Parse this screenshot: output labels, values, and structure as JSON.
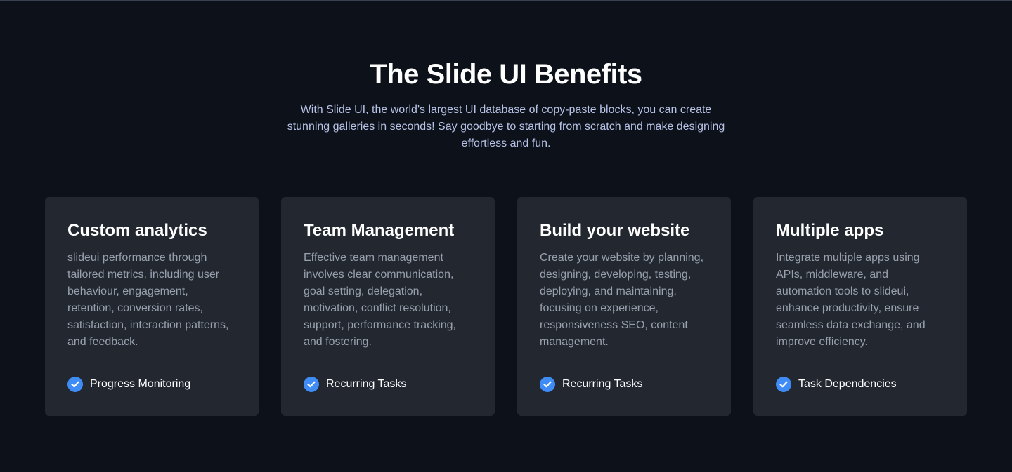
{
  "section": {
    "title": "The Slide UI Benefits",
    "subtitle": "With Slide UI, the world's largest UI database of copy-paste blocks, you can create stunning galleries in seconds! Say goodbye to starting from scratch and make designing effortless and fun."
  },
  "colors": {
    "background": "#0d111a",
    "card": "#232830",
    "accent": "#3f8cf7",
    "subtitle": "#b7c3e6",
    "description": "#98a0ae"
  },
  "cards": [
    {
      "title": "Custom analytics",
      "description": "slideui performance through tailored metrics, including user behaviour, engagement, retention, conversion rates, satisfaction, interaction patterns, and feedback.",
      "feature": "Progress Monitoring",
      "icon": "check-circle-icon"
    },
    {
      "title": "Team Management",
      "description": "Effective team management involves clear communication, goal setting, delegation, motivation, conflict resolution, support, performance tracking, and fostering.",
      "feature": "Recurring Tasks",
      "icon": "check-circle-icon"
    },
    {
      "title": "Build your website",
      "description": "Create your website by planning, designing, developing, testing, deploying, and maintaining, focusing on experience, responsiveness SEO, content management.",
      "feature": "Recurring Tasks",
      "icon": "check-circle-icon"
    },
    {
      "title": "Multiple apps",
      "description": "Integrate multiple apps using APIs, middleware, and automation tools to slideui, enhance productivity, ensure seamless data exchange, and improve efficiency.",
      "feature": "Task Dependencies",
      "icon": "check-circle-icon"
    }
  ]
}
